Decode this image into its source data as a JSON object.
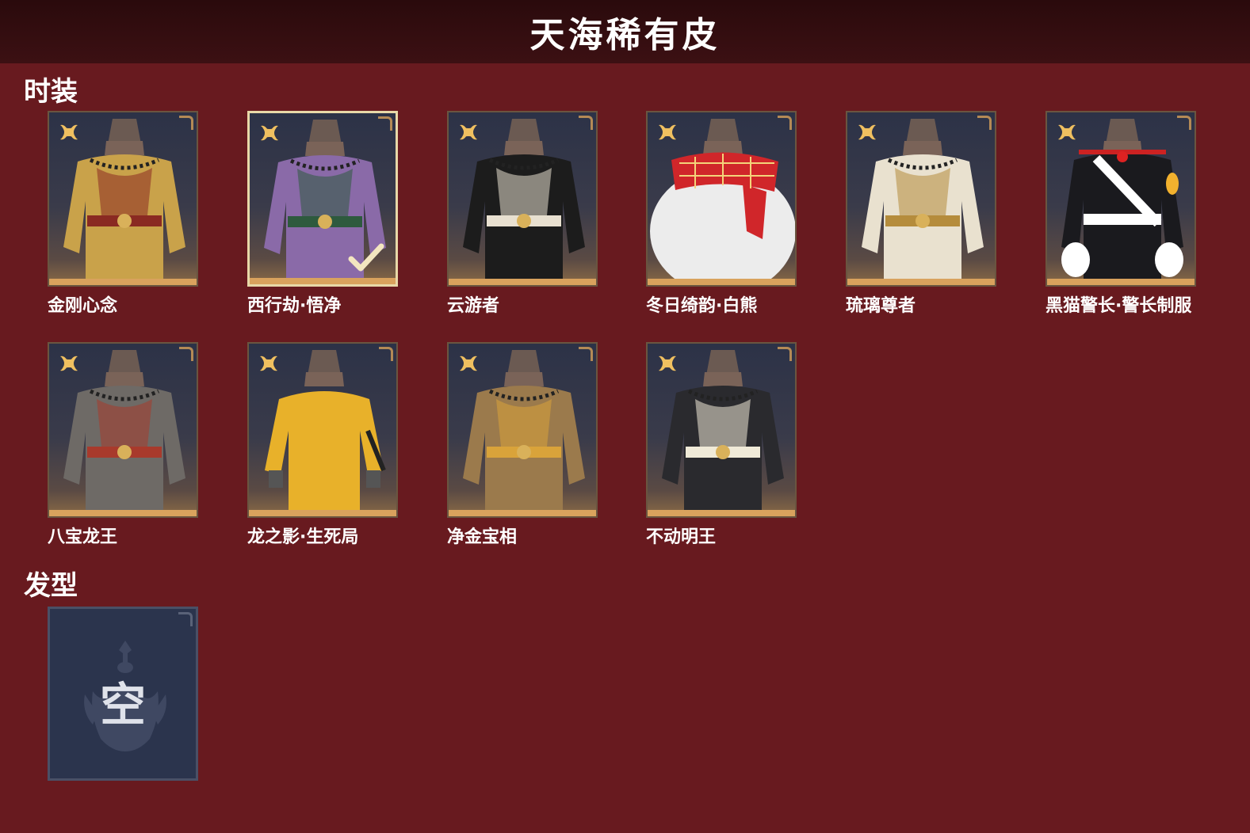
{
  "header": {
    "title": "天海稀有皮"
  },
  "sections": {
    "outfits_title": "时装",
    "hairstyle_title": "发型"
  },
  "outfits": [
    {
      "name": "金刚心念",
      "selected": false,
      "theme": "gold-armor",
      "colors": {
        "main": "#c9a24a",
        "accent": "#8a2a22"
      }
    },
    {
      "name": "西行劫·悟净",
      "selected": true,
      "theme": "purple-monk",
      "colors": {
        "main": "#8a6aa8",
        "accent": "#2e5a3e"
      }
    },
    {
      "name": "云游者",
      "selected": false,
      "theme": "wanderer",
      "colors": {
        "main": "#1c1c1c",
        "accent": "#e8e0d0"
      }
    },
    {
      "name": "冬日绮韵·白熊",
      "selected": false,
      "theme": "white-bear",
      "colors": {
        "main": "#eeeeee",
        "accent": "#d0262a"
      }
    },
    {
      "name": "琉璃尊者",
      "selected": false,
      "theme": "white-gold",
      "colors": {
        "main": "#e9e1cf",
        "accent": "#b58c3c"
      }
    },
    {
      "name": "黑猫警长·警长制服",
      "selected": false,
      "theme": "black-uniform",
      "colors": {
        "main": "#1a1a1e",
        "accent": "#ffffff"
      }
    },
    {
      "name": "八宝龙王",
      "selected": false,
      "theme": "dragon-king",
      "colors": {
        "main": "#6e6a66",
        "accent": "#a83a2c"
      }
    },
    {
      "name": "龙之影·生死局",
      "selected": false,
      "theme": "yellow-jumpsuit",
      "colors": {
        "main": "#e8b12a",
        "accent": "#222222"
      }
    },
    {
      "name": "净金宝相",
      "selected": false,
      "theme": "gold-vest",
      "colors": {
        "main": "#9b7a4c",
        "accent": "#d9a33a"
      }
    },
    {
      "name": "不动明王",
      "selected": false,
      "theme": "dark-robe",
      "colors": {
        "main": "#2a2a2e",
        "accent": "#f0ead8"
      }
    }
  ],
  "hairstyle": {
    "empty_label": "空"
  },
  "icons": {
    "rarity": "gold-flower-icon",
    "selected": "checkmark-icon",
    "empty": "helmet-emblem-icon"
  },
  "colors": {
    "background": "#681a1f",
    "header": "#2a0a0c",
    "card_bar": "#d9a25d",
    "rarity_gold": "#f0c060"
  }
}
